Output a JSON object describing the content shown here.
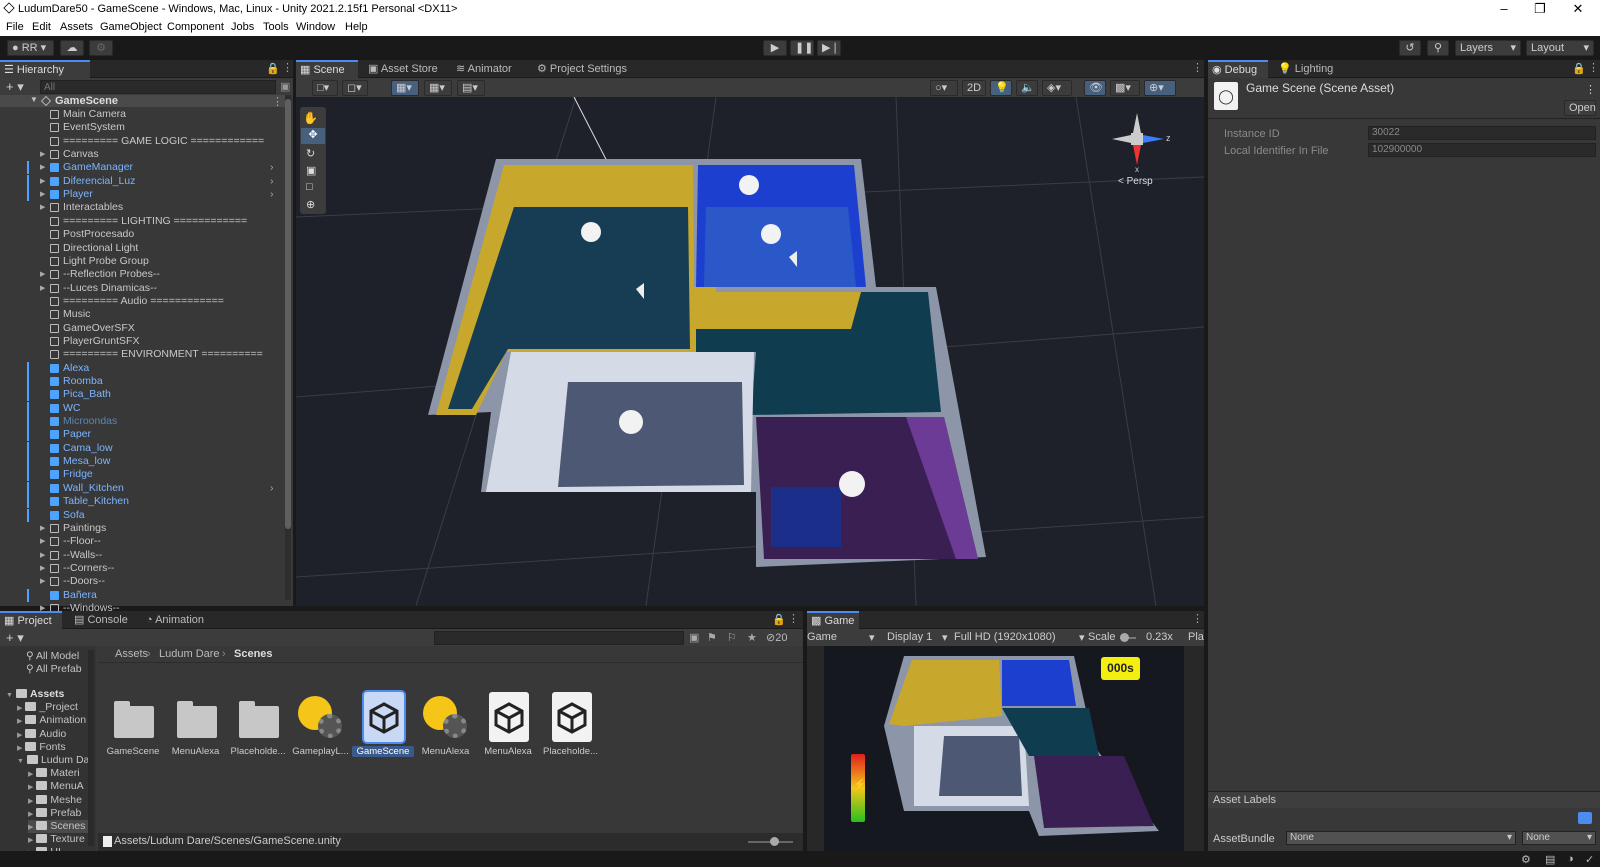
{
  "window": {
    "title": "LudumDare50 - GameScene - Windows, Mac, Linux - Unity 2021.2.15f1 Personal <DX11>"
  },
  "menu": [
    "File",
    "Edit",
    "Assets",
    "GameObject",
    "Component",
    "Jobs",
    "Tools",
    "Window",
    "Help"
  ],
  "toolbar": {
    "account": "RR",
    "layers": "Layers",
    "layout": "Layout"
  },
  "hierarchy": {
    "tab": "Hierarchy",
    "search_placeholder": "All",
    "root": "GameScene",
    "items": [
      {
        "label": "Main Camera",
        "prefab": false,
        "arrow": false
      },
      {
        "label": "EventSystem",
        "prefab": false,
        "arrow": false
      },
      {
        "label": "========= GAME LOGIC ============",
        "prefab": false,
        "arrow": false
      },
      {
        "label": "Canvas",
        "prefab": false,
        "arrow": true
      },
      {
        "label": "GameManager",
        "prefab": true,
        "arrow": true
      },
      {
        "label": "Diferencial_Luz",
        "prefab": true,
        "arrow": true
      },
      {
        "label": "Player",
        "prefab": true,
        "arrow": true
      },
      {
        "label": "Interactables",
        "prefab": false,
        "arrow": true
      },
      {
        "label": "========= LIGHTING ============",
        "prefab": false,
        "arrow": false
      },
      {
        "label": "PostProcesado",
        "prefab": false,
        "arrow": false
      },
      {
        "label": "Directional Light",
        "prefab": false,
        "arrow": false
      },
      {
        "label": "Light Probe Group",
        "prefab": false,
        "arrow": false
      },
      {
        "label": "--Reflection Probes--",
        "prefab": false,
        "arrow": true
      },
      {
        "label": "--Luces Dinamicas--",
        "prefab": false,
        "arrow": true
      },
      {
        "label": "========= Audio ============",
        "prefab": false,
        "arrow": false
      },
      {
        "label": "Music",
        "prefab": false,
        "arrow": false
      },
      {
        "label": "GameOverSFX",
        "prefab": false,
        "arrow": false
      },
      {
        "label": "PlayerGruntSFX",
        "prefab": false,
        "arrow": false
      },
      {
        "label": "========= ENVIRONMENT ==========",
        "prefab": false,
        "arrow": false
      },
      {
        "label": "Alexa",
        "prefab": true,
        "arrow": false
      },
      {
        "label": "Roomba",
        "prefab": true,
        "arrow": false
      },
      {
        "label": "Pica_Bath",
        "prefab": true,
        "arrow": false
      },
      {
        "label": "WC",
        "prefab": true,
        "arrow": false
      },
      {
        "label": "Microondas",
        "prefab": true,
        "arrow": false,
        "dim": true
      },
      {
        "label": "Paper",
        "prefab": true,
        "arrow": false
      },
      {
        "label": "Cama_low",
        "prefab": true,
        "arrow": false
      },
      {
        "label": "Mesa_low",
        "prefab": true,
        "arrow": false
      },
      {
        "label": "Fridge",
        "prefab": true,
        "arrow": false
      },
      {
        "label": "Wall_Kitchen",
        "prefab": true,
        "arrow": false
      },
      {
        "label": "Table_Kitchen",
        "prefab": true,
        "arrow": false
      },
      {
        "label": "Sofa",
        "prefab": true,
        "arrow": false
      },
      {
        "label": "Paintings",
        "prefab": false,
        "arrow": true
      },
      {
        "label": "--Floor--",
        "prefab": false,
        "arrow": true
      },
      {
        "label": "--Walls--",
        "prefab": false,
        "arrow": true
      },
      {
        "label": "--Corners--",
        "prefab": false,
        "arrow": true
      },
      {
        "label": "--Doors--",
        "prefab": false,
        "arrow": true
      },
      {
        "label": "Bañera",
        "prefab": true,
        "arrow": false
      },
      {
        "label": "--Windows--",
        "prefab": false,
        "arrow": true
      }
    ]
  },
  "scene_tabs": [
    "Scene",
    "Asset Store",
    "Animator",
    "Project Settings"
  ],
  "scene_view": {
    "mode_2d": "2D",
    "persp": "< Persp",
    "axis_z": "z",
    "axis_x": "x"
  },
  "inspector": {
    "tabs": [
      "Debug",
      "Lighting"
    ],
    "asset_title": "Game Scene (Scene Asset)",
    "open_button": "Open",
    "instance_id_label": "Instance ID",
    "instance_id": "30022",
    "local_id_label": "Local Identifier In File",
    "local_id": "102900000",
    "asset_labels": "Asset Labels",
    "assetbundle_label": "AssetBundle",
    "assetbundle_value": "None",
    "variant_value": "None"
  },
  "project": {
    "tabs": [
      "Project",
      "Console",
      "Animation"
    ],
    "hidden_count": "20",
    "breadcrumb": [
      "Assets",
      "Ludum Dare",
      "Scenes"
    ],
    "favorites": [
      "All Model",
      "All Prefab"
    ],
    "tree": [
      "Assets",
      "_Project",
      "Animation",
      "Audio",
      "Fonts",
      "Ludum Da",
      "Materi",
      "MenuA",
      "Meshe",
      "Prefab",
      "Scenes",
      "Texture",
      "UI"
    ],
    "tiles": [
      {
        "label": "GameScene",
        "kind": "folder"
      },
      {
        "label": "MenuAlexa",
        "kind": "folder"
      },
      {
        "label": "Placeholde...",
        "kind": "folder"
      },
      {
        "label": "GameplayL...",
        "kind": "lighting"
      },
      {
        "label": "GameScene",
        "kind": "scene",
        "selected": true
      },
      {
        "label": "MenuAlexa",
        "kind": "lighting"
      },
      {
        "label": "MenuAlexa",
        "kind": "scene"
      },
      {
        "label": "Placeholde...",
        "kind": "scene"
      }
    ],
    "path": "Assets/Ludum Dare/Scenes/GameScene.unity"
  },
  "game": {
    "tab": "Game",
    "mode": "Game",
    "display": "Display 1",
    "resolution": "Full HD (1920x1080)",
    "scale_label": "Scale",
    "scale_value": "0.23x",
    "play_focused": "Pla",
    "timer": "000s"
  }
}
